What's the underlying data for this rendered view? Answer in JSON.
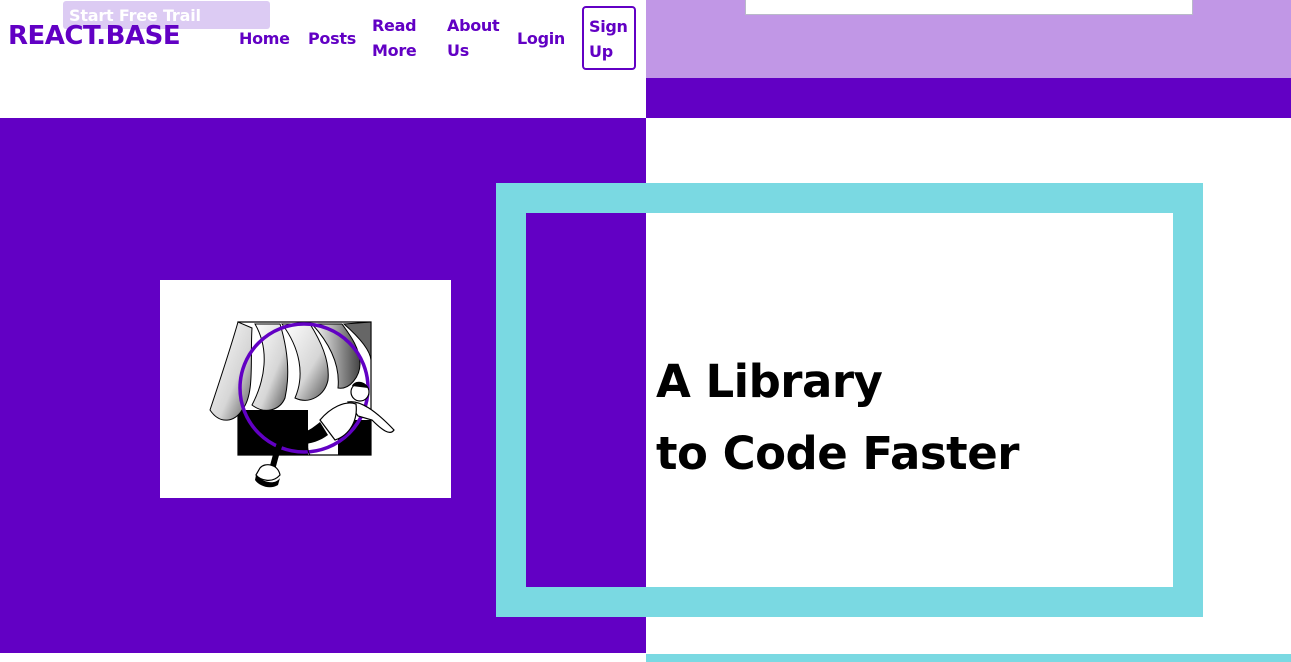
{
  "header": {
    "trial_button_label": "Start Free Trail",
    "brand": "REACT.BASE",
    "nav": {
      "home": "Home",
      "posts": "Posts",
      "read_more_1": "Read",
      "read_more_2": "More",
      "about_1": "About",
      "about_2": "Us",
      "login": "Login",
      "signup_1": "Sign",
      "signup_2": "Up"
    }
  },
  "hero": {
    "headline_line1": "A Library",
    "headline_line2": "to Code Faster",
    "illustration": "person-escaping-through-wall-illustration"
  },
  "colors": {
    "purple": "#6200c4",
    "lilac": "#c197e6",
    "cyan": "#7ad9e2",
    "trial_button": "#dccbf3"
  }
}
